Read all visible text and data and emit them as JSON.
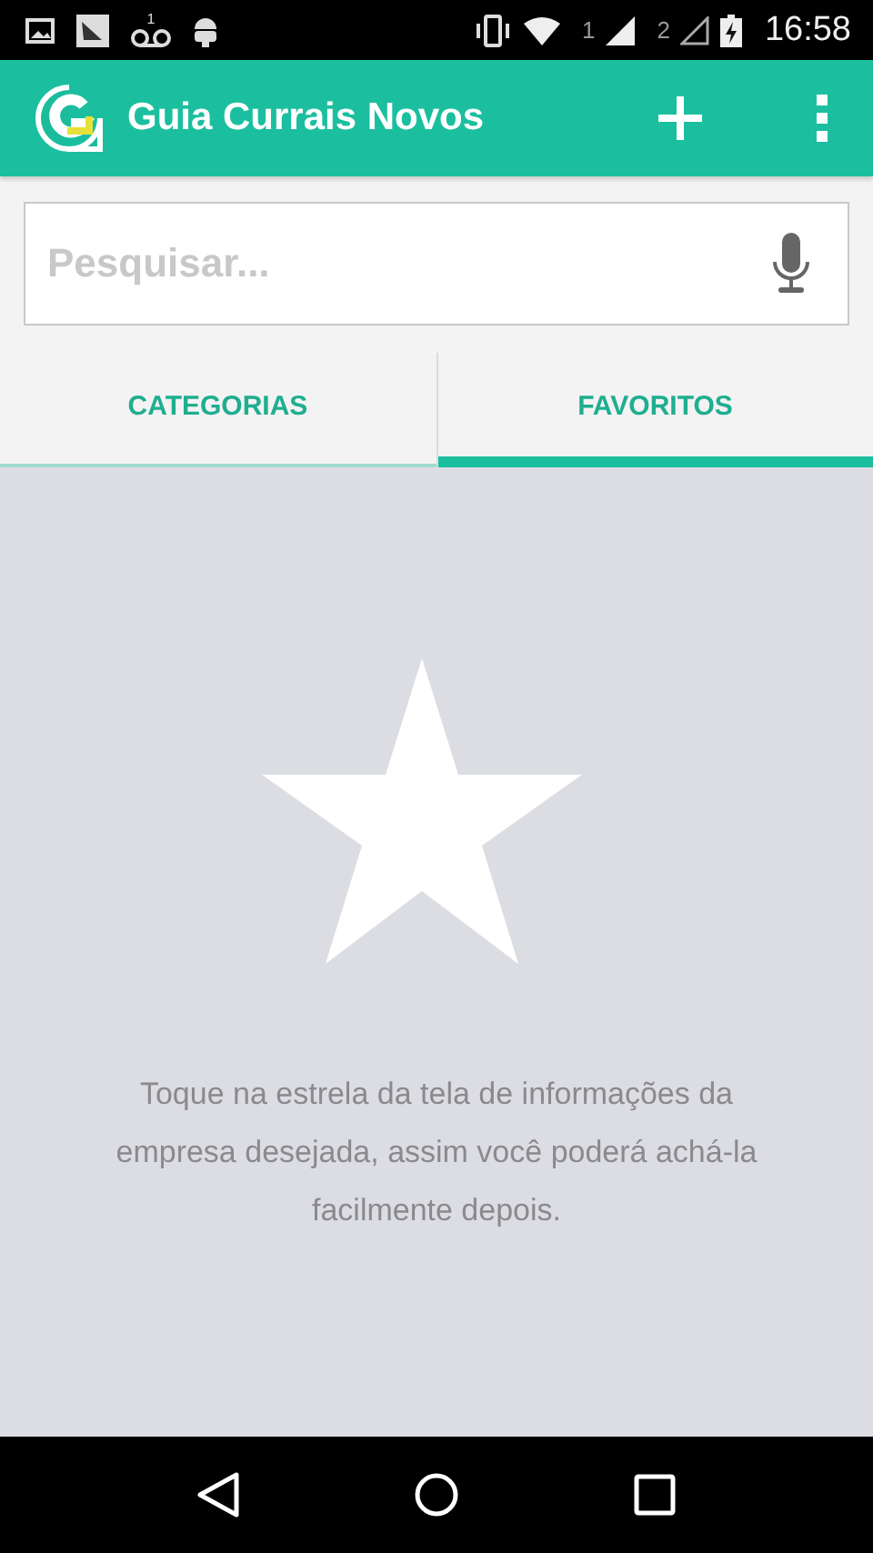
{
  "status_bar": {
    "voicemail_count": "1",
    "sim_1": "1",
    "sim_2": "2",
    "time": "16:58"
  },
  "app_bar": {
    "title": "Guia Currais Novos"
  },
  "search": {
    "placeholder": "Pesquisar..."
  },
  "tabs": [
    {
      "label": "CATEGORIAS",
      "selected": false
    },
    {
      "label": "FAVORITOS",
      "selected": true
    }
  ],
  "empty_state": {
    "message": "Toque na estrela da tela de informações da empresa desejada, assim você poderá achá-la facilmente depois."
  }
}
